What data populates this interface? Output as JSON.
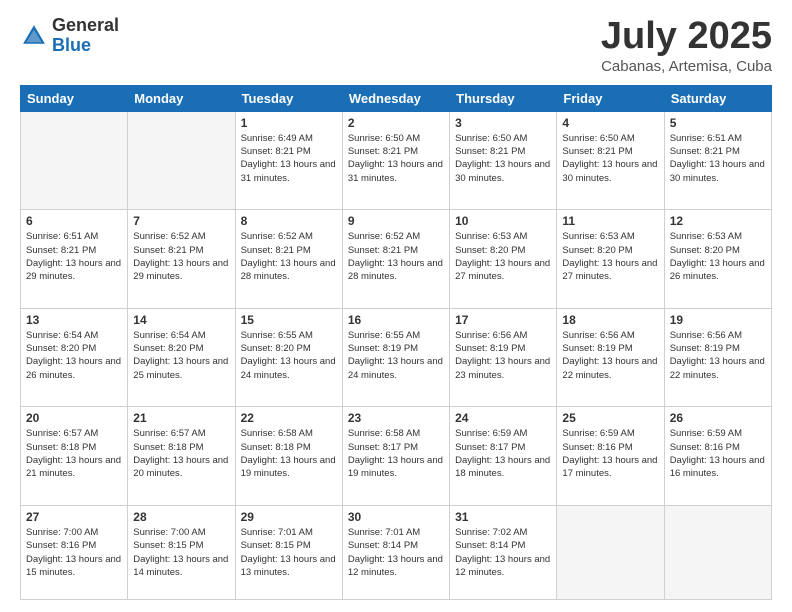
{
  "header": {
    "logo_general": "General",
    "logo_blue": "Blue",
    "title": "July 2025",
    "subtitle": "Cabanas, Artemisa, Cuba"
  },
  "days_of_week": [
    "Sunday",
    "Monday",
    "Tuesday",
    "Wednesday",
    "Thursday",
    "Friday",
    "Saturday"
  ],
  "weeks": [
    [
      {
        "day": "",
        "info": ""
      },
      {
        "day": "",
        "info": ""
      },
      {
        "day": "1",
        "sunrise": "Sunrise: 6:49 AM",
        "sunset": "Sunset: 8:21 PM",
        "daylight": "Daylight: 13 hours and 31 minutes."
      },
      {
        "day": "2",
        "sunrise": "Sunrise: 6:50 AM",
        "sunset": "Sunset: 8:21 PM",
        "daylight": "Daylight: 13 hours and 31 minutes."
      },
      {
        "day": "3",
        "sunrise": "Sunrise: 6:50 AM",
        "sunset": "Sunset: 8:21 PM",
        "daylight": "Daylight: 13 hours and 30 minutes."
      },
      {
        "day": "4",
        "sunrise": "Sunrise: 6:50 AM",
        "sunset": "Sunset: 8:21 PM",
        "daylight": "Daylight: 13 hours and 30 minutes."
      },
      {
        "day": "5",
        "sunrise": "Sunrise: 6:51 AM",
        "sunset": "Sunset: 8:21 PM",
        "daylight": "Daylight: 13 hours and 30 minutes."
      }
    ],
    [
      {
        "day": "6",
        "sunrise": "Sunrise: 6:51 AM",
        "sunset": "Sunset: 8:21 PM",
        "daylight": "Daylight: 13 hours and 29 minutes."
      },
      {
        "day": "7",
        "sunrise": "Sunrise: 6:52 AM",
        "sunset": "Sunset: 8:21 PM",
        "daylight": "Daylight: 13 hours and 29 minutes."
      },
      {
        "day": "8",
        "sunrise": "Sunrise: 6:52 AM",
        "sunset": "Sunset: 8:21 PM",
        "daylight": "Daylight: 13 hours and 28 minutes."
      },
      {
        "day": "9",
        "sunrise": "Sunrise: 6:52 AM",
        "sunset": "Sunset: 8:21 PM",
        "daylight": "Daylight: 13 hours and 28 minutes."
      },
      {
        "day": "10",
        "sunrise": "Sunrise: 6:53 AM",
        "sunset": "Sunset: 8:20 PM",
        "daylight": "Daylight: 13 hours and 27 minutes."
      },
      {
        "day": "11",
        "sunrise": "Sunrise: 6:53 AM",
        "sunset": "Sunset: 8:20 PM",
        "daylight": "Daylight: 13 hours and 27 minutes."
      },
      {
        "day": "12",
        "sunrise": "Sunrise: 6:53 AM",
        "sunset": "Sunset: 8:20 PM",
        "daylight": "Daylight: 13 hours and 26 minutes."
      }
    ],
    [
      {
        "day": "13",
        "sunrise": "Sunrise: 6:54 AM",
        "sunset": "Sunset: 8:20 PM",
        "daylight": "Daylight: 13 hours and 26 minutes."
      },
      {
        "day": "14",
        "sunrise": "Sunrise: 6:54 AM",
        "sunset": "Sunset: 8:20 PM",
        "daylight": "Daylight: 13 hours and 25 minutes."
      },
      {
        "day": "15",
        "sunrise": "Sunrise: 6:55 AM",
        "sunset": "Sunset: 8:20 PM",
        "daylight": "Daylight: 13 hours and 24 minutes."
      },
      {
        "day": "16",
        "sunrise": "Sunrise: 6:55 AM",
        "sunset": "Sunset: 8:19 PM",
        "daylight": "Daylight: 13 hours and 24 minutes."
      },
      {
        "day": "17",
        "sunrise": "Sunrise: 6:56 AM",
        "sunset": "Sunset: 8:19 PM",
        "daylight": "Daylight: 13 hours and 23 minutes."
      },
      {
        "day": "18",
        "sunrise": "Sunrise: 6:56 AM",
        "sunset": "Sunset: 8:19 PM",
        "daylight": "Daylight: 13 hours and 22 minutes."
      },
      {
        "day": "19",
        "sunrise": "Sunrise: 6:56 AM",
        "sunset": "Sunset: 8:19 PM",
        "daylight": "Daylight: 13 hours and 22 minutes."
      }
    ],
    [
      {
        "day": "20",
        "sunrise": "Sunrise: 6:57 AM",
        "sunset": "Sunset: 8:18 PM",
        "daylight": "Daylight: 13 hours and 21 minutes."
      },
      {
        "day": "21",
        "sunrise": "Sunrise: 6:57 AM",
        "sunset": "Sunset: 8:18 PM",
        "daylight": "Daylight: 13 hours and 20 minutes."
      },
      {
        "day": "22",
        "sunrise": "Sunrise: 6:58 AM",
        "sunset": "Sunset: 8:18 PM",
        "daylight": "Daylight: 13 hours and 19 minutes."
      },
      {
        "day": "23",
        "sunrise": "Sunrise: 6:58 AM",
        "sunset": "Sunset: 8:17 PM",
        "daylight": "Daylight: 13 hours and 19 minutes."
      },
      {
        "day": "24",
        "sunrise": "Sunrise: 6:59 AM",
        "sunset": "Sunset: 8:17 PM",
        "daylight": "Daylight: 13 hours and 18 minutes."
      },
      {
        "day": "25",
        "sunrise": "Sunrise: 6:59 AM",
        "sunset": "Sunset: 8:16 PM",
        "daylight": "Daylight: 13 hours and 17 minutes."
      },
      {
        "day": "26",
        "sunrise": "Sunrise: 6:59 AM",
        "sunset": "Sunset: 8:16 PM",
        "daylight": "Daylight: 13 hours and 16 minutes."
      }
    ],
    [
      {
        "day": "27",
        "sunrise": "Sunrise: 7:00 AM",
        "sunset": "Sunset: 8:16 PM",
        "daylight": "Daylight: 13 hours and 15 minutes."
      },
      {
        "day": "28",
        "sunrise": "Sunrise: 7:00 AM",
        "sunset": "Sunset: 8:15 PM",
        "daylight": "Daylight: 13 hours and 14 minutes."
      },
      {
        "day": "29",
        "sunrise": "Sunrise: 7:01 AM",
        "sunset": "Sunset: 8:15 PM",
        "daylight": "Daylight: 13 hours and 13 minutes."
      },
      {
        "day": "30",
        "sunrise": "Sunrise: 7:01 AM",
        "sunset": "Sunset: 8:14 PM",
        "daylight": "Daylight: 13 hours and 12 minutes."
      },
      {
        "day": "31",
        "sunrise": "Sunrise: 7:02 AM",
        "sunset": "Sunset: 8:14 PM",
        "daylight": "Daylight: 13 hours and 12 minutes."
      },
      {
        "day": "",
        "info": ""
      },
      {
        "day": "",
        "info": ""
      }
    ]
  ]
}
